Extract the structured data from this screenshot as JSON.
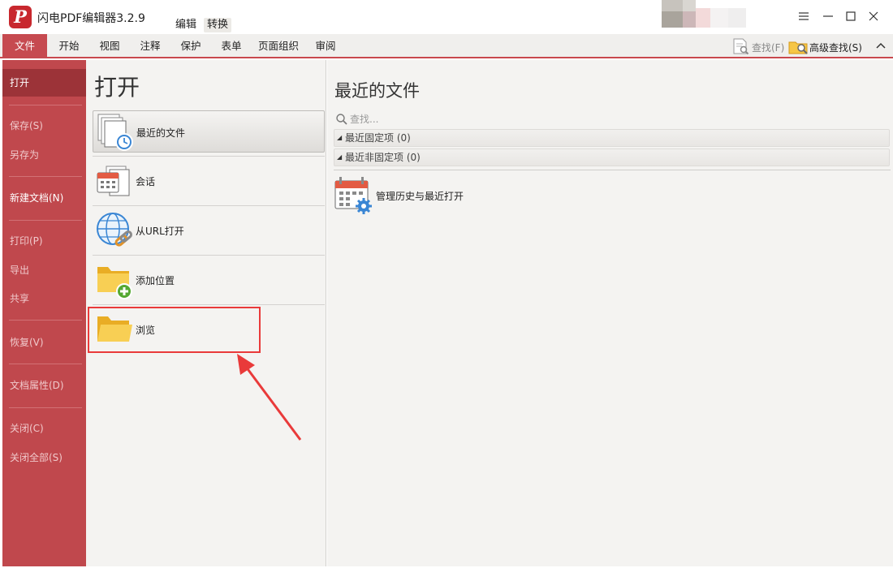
{
  "app": {
    "logo_letter": "P",
    "title": "闪电PDF编辑器3.2.9",
    "context_tabs": [
      "编辑",
      "转换"
    ]
  },
  "ribbon": {
    "tabs": [
      "文件",
      "开始",
      "视图",
      "注释",
      "保护",
      "表单",
      "页面组织",
      "审阅"
    ],
    "find_label": "查找(F)",
    "advanced_find_label": "高级查找(S)"
  },
  "file_menu": {
    "items": [
      "打开",
      "保存(S)",
      "另存为",
      "新建文档(N)",
      "打印(P)",
      "导出",
      "共享",
      "恢复(V)",
      "文档属性(D)",
      "关闭(C)",
      "关闭全部(S)"
    ]
  },
  "open_panel": {
    "title": "打开",
    "options": [
      "最近的文件",
      "会话",
      "从URL打开",
      "添加位置",
      "浏览"
    ]
  },
  "recent_panel": {
    "title": "最近的文件",
    "search_placeholder": "查找...",
    "groups": [
      "最近固定项 (0)",
      "最近非固定项 (0)"
    ],
    "manage_label": "管理历史与最近打开"
  },
  "colors": {
    "brand_red": "#c8282e",
    "menu_red": "#c0484d",
    "menu_active": "#9c3338",
    "annotation_red": "#e93a3a"
  }
}
